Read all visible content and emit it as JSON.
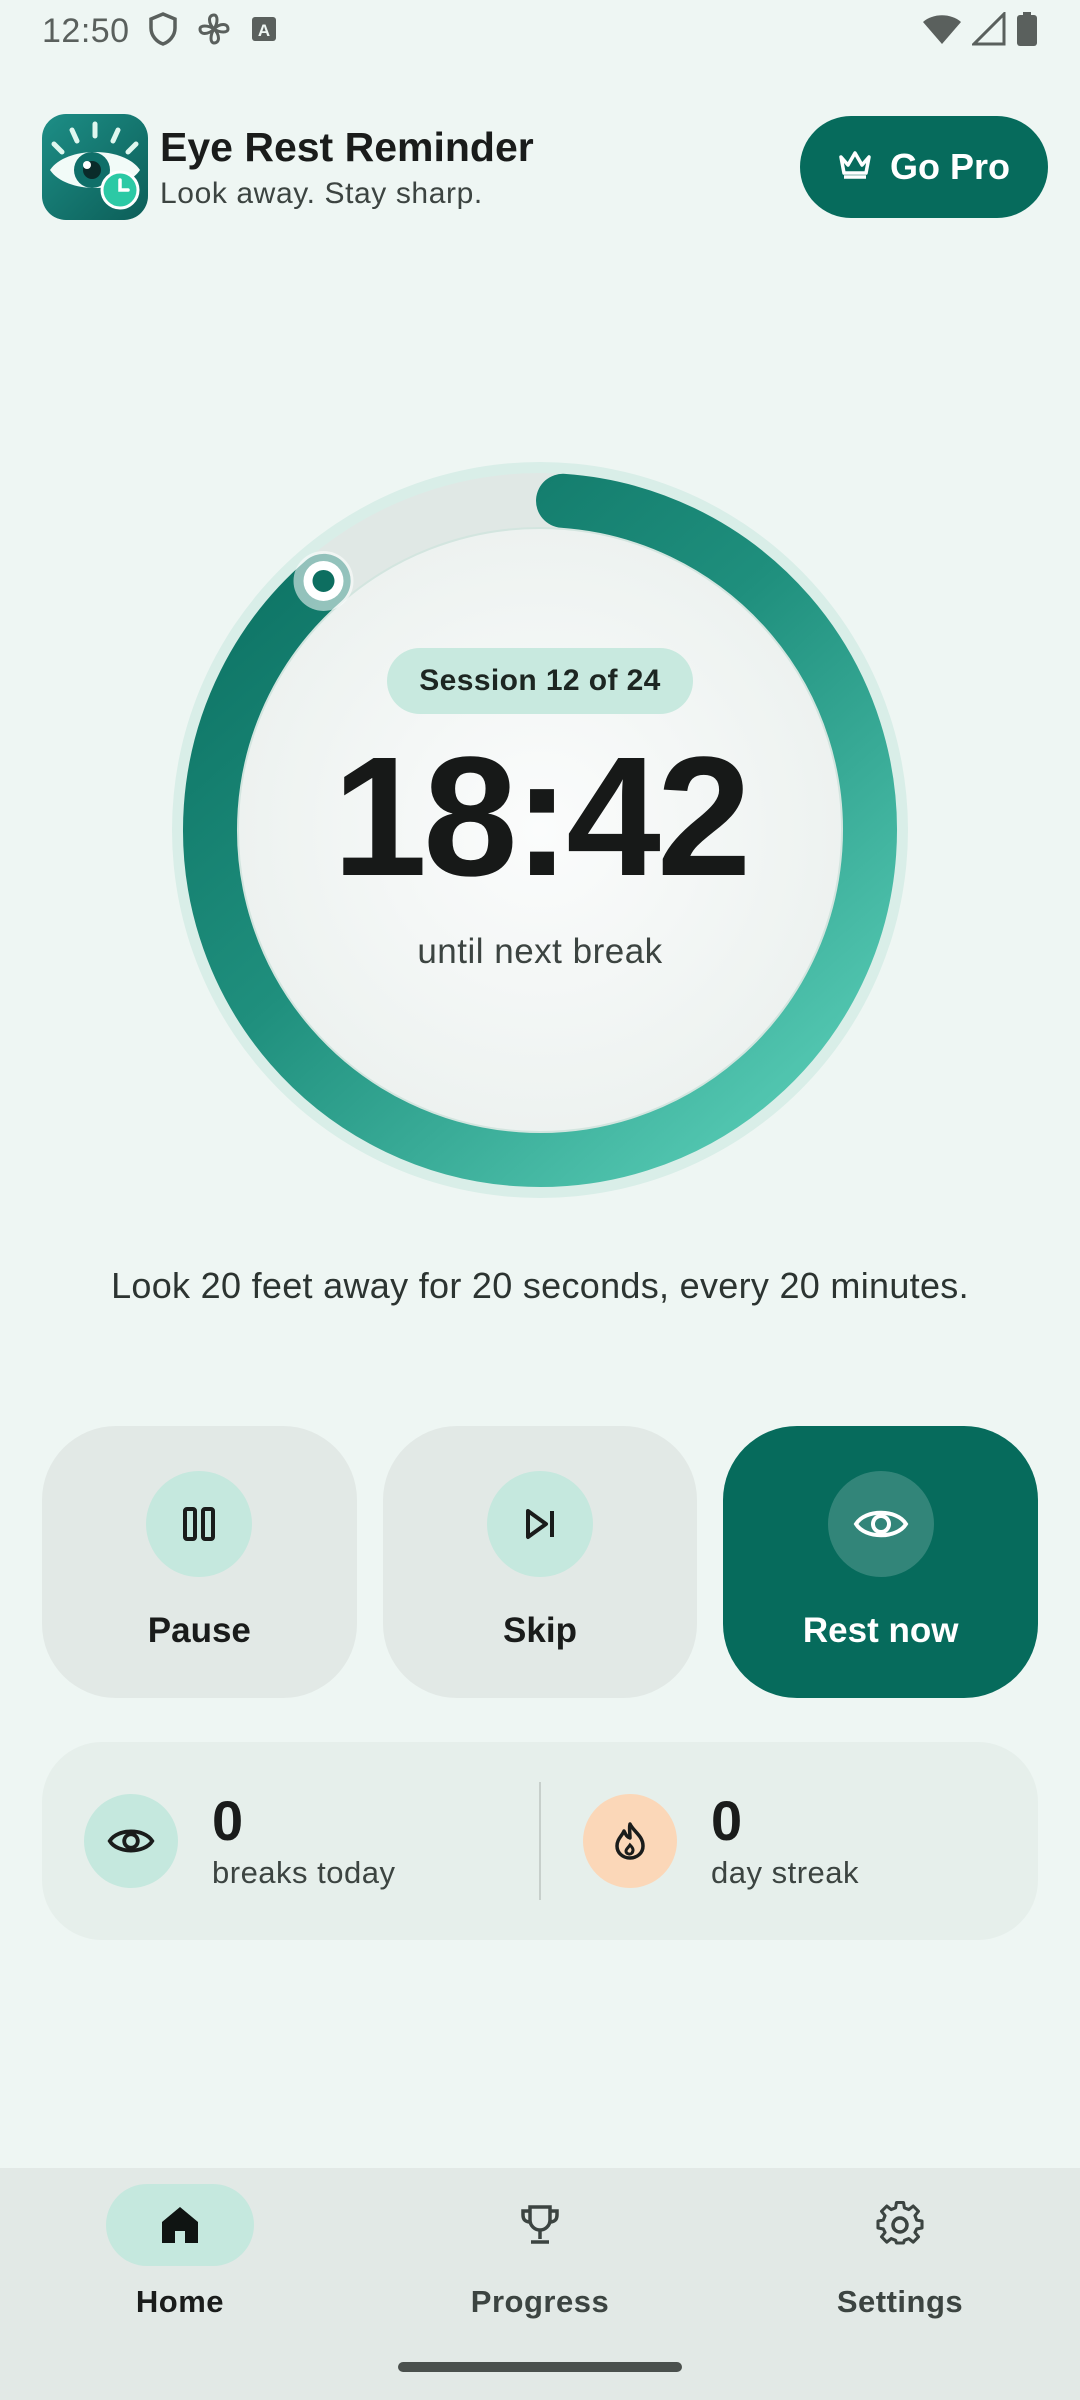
{
  "status_bar": {
    "time": "12:50",
    "icons": [
      "shield-icon",
      "pinwheel-icon",
      "keyboard-a-icon",
      "wifi-icon",
      "signal-icon",
      "battery-icon"
    ]
  },
  "header": {
    "app_name": "Eye Rest Reminder",
    "tagline": "Look away. Stay sharp.",
    "go_pro_label": "Go Pro",
    "go_pro_icon": "crown-icon"
  },
  "timer": {
    "session_label": "Session 12 of 24",
    "countdown": "18:42",
    "caption": "until next break",
    "progress_fraction": 0.875
  },
  "tip": "Look 20 feet away for 20 seconds, every 20 minutes.",
  "actions": [
    {
      "label": "Pause",
      "icon": "pause-icon"
    },
    {
      "label": "Skip",
      "icon": "skip-next-icon"
    },
    {
      "label": "Rest now",
      "icon": "eye-icon"
    }
  ],
  "stats": {
    "breaks_today": {
      "value": "0",
      "label": "breaks today",
      "icon": "eye-icon"
    },
    "day_streak": {
      "value": "0",
      "label": "day streak",
      "icon": "flame-icon"
    }
  },
  "nav": {
    "items": [
      {
        "label": "Home",
        "icon": "home-icon",
        "active": true
      },
      {
        "label": "Progress",
        "icon": "trophy-icon",
        "active": false
      },
      {
        "label": "Settings",
        "icon": "gear-icon",
        "active": false
      }
    ]
  },
  "colors": {
    "primary": "#066b5c",
    "ring_light": "#5fd4bd",
    "ring_dark": "#0a6e60",
    "background": "#eef6f3",
    "streak_accent": "#fbd7b8"
  }
}
